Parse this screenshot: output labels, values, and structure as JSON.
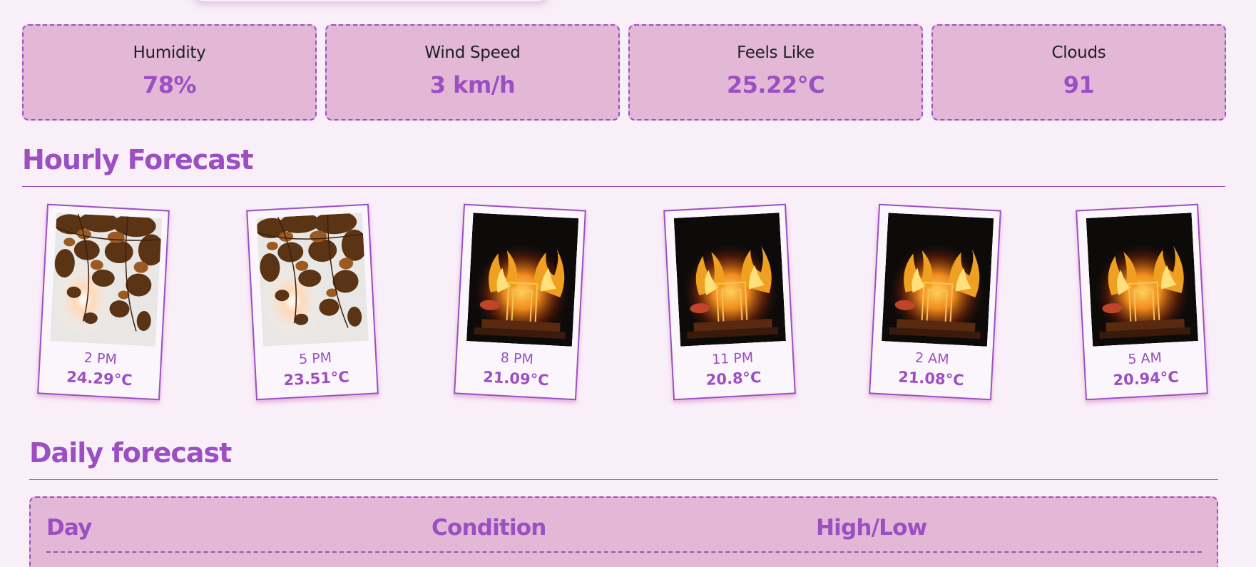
{
  "stats": [
    {
      "label": "Humidity",
      "value": "78%"
    },
    {
      "label": "Wind Speed",
      "value": "3 km/h"
    },
    {
      "label": "Feels Like",
      "value": "25.22°C"
    },
    {
      "label": "Clouds",
      "value": "91"
    }
  ],
  "hourly": {
    "title": "Hourly Forecast",
    "items": [
      {
        "time": "2 PM",
        "temp": "24.29°C",
        "image": "autumn-leaves-sun"
      },
      {
        "time": "5 PM",
        "temp": "23.51°C",
        "image": "autumn-leaves-sun"
      },
      {
        "time": "8 PM",
        "temp": "21.09°C",
        "image": "burning-fire"
      },
      {
        "time": "11 PM",
        "temp": "20.8°C",
        "image": "burning-fire"
      },
      {
        "time": "2 AM",
        "temp": "21.08°C",
        "image": "burning-fire"
      },
      {
        "time": "5 AM",
        "temp": "20.94°C",
        "image": "burning-fire"
      }
    ]
  },
  "daily": {
    "title": "Daily forecast",
    "headers": {
      "day": "Day",
      "condition": "Condition",
      "high_low": "High/Low"
    }
  },
  "colors": {
    "accent": "#9b4fc2",
    "card_bg": "#e3b8d6",
    "page_bg": "#f8eff9"
  }
}
